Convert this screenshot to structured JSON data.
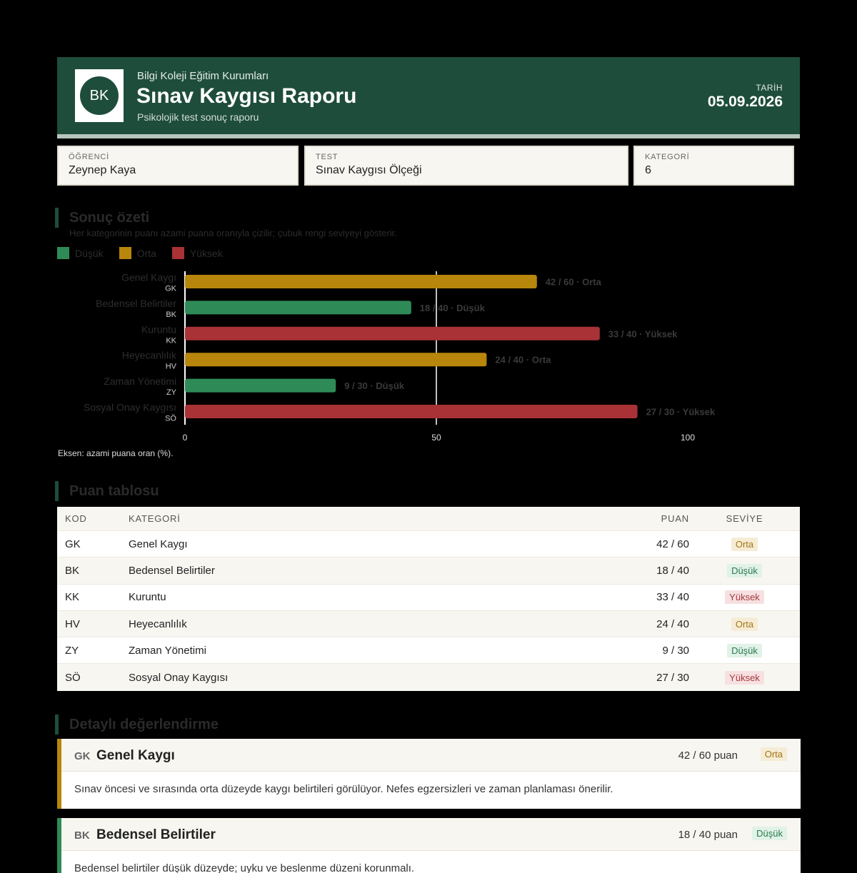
{
  "header": {
    "logo_text": "BK",
    "org": "Bilgi Koleji Eğitim Kurumları",
    "title": "Sınav Kaygısı Raporu",
    "subtitle": "Psikolojik test sonuç raporu",
    "date_label": "TARİH",
    "date": "05.09.2026"
  },
  "info": {
    "student_label": "ÖĞRENCİ",
    "student": "Zeynep Kaya",
    "test_label": "TEST",
    "test": "Sınav Kaygısı Ölçeği",
    "category_label": "KATEGORİ",
    "category_count": "6"
  },
  "summary": {
    "title": "Sonuç özeti",
    "description": "Her kategorinin puanı azami puana oranıyla çizilir; çubuk rengi seviyeyi gösterir.",
    "legend": [
      {
        "label": "Düşük",
        "color": "#2e8b57"
      },
      {
        "label": "Orta",
        "color": "#b8860b"
      },
      {
        "label": "Yüksek",
        "color": "#a83236"
      }
    ],
    "axis_note": "Eksen: azami puana oran (%)."
  },
  "chart_data": {
    "type": "bar",
    "orientation": "horizontal",
    "categories": [
      "Genel Kaygı",
      "Bedensel Belirtiler",
      "Kuruntu",
      "Heyecanlılık",
      "Zaman Yönetimi",
      "Sosyal Onay Kaygısı"
    ],
    "codes": [
      "GK",
      "BK",
      "KK",
      "HV",
      "ZY",
      "SÖ"
    ],
    "scores": [
      42,
      18,
      33,
      24,
      9,
      27
    ],
    "max_scores": [
      60,
      40,
      40,
      40,
      30,
      30
    ],
    "values": [
      70,
      45,
      82.5,
      60,
      30,
      90
    ],
    "levels": [
      "Orta",
      "Düşük",
      "Yüksek",
      "Orta",
      "Düşük",
      "Yüksek"
    ],
    "data_labels": [
      "42 / 60 · Orta",
      "18 / 40 · Düşük",
      "33 / 40 · Yüksek",
      "24 / 40 · Orta",
      "9 / 30 · Düşük",
      "27 / 30 · Yüksek"
    ],
    "xlim": [
      0,
      100
    ],
    "xticks": [
      "0",
      "50",
      "100"
    ],
    "reference_line": 50,
    "level_colors": {
      "Düşük": "#2e8b57",
      "Orta": "#b8860b",
      "Yüksek": "#a83236"
    }
  },
  "table": {
    "title": "Puan tablosu",
    "headers": [
      "KOD",
      "KATEGORİ",
      "PUAN",
      "SEVİYE"
    ],
    "rows": [
      {
        "code": "GK",
        "category": "Genel Kaygı",
        "score": "42 / 60",
        "level": "Orta"
      },
      {
        "code": "BK",
        "category": "Bedensel Belirtiler",
        "score": "18 / 40",
        "level": "Düşük"
      },
      {
        "code": "KK",
        "category": "Kuruntu",
        "score": "33 / 40",
        "level": "Yüksek"
      },
      {
        "code": "HV",
        "category": "Heyecanlılık",
        "score": "24 / 40",
        "level": "Orta"
      },
      {
        "code": "ZY",
        "category": "Zaman Yönetimi",
        "score": "9 / 30",
        "level": "Düşük"
      },
      {
        "code": "SÖ",
        "category": "Sosyal Onay Kaygısı",
        "score": "27 / 30",
        "level": "Yüksek"
      }
    ]
  },
  "details": {
    "title": "Detaylı değerlendirme",
    "cards": [
      {
        "code": "GK",
        "name": "Genel Kaygı",
        "score": "42 / 60 puan",
        "level": "Orta",
        "text": "Sınav öncesi ve sırasında orta düzeyde kaygı belirtileri görülüyor. Nefes egzersizleri ve zaman planlaması önerilir."
      },
      {
        "code": "BK",
        "name": "Bedensel Belirtiler",
        "score": "18 / 40 puan",
        "level": "Düşük",
        "text": "Bedensel belirtiler düşük düzeyde; uyku ve beslenme düzeni korunmalı."
      }
    ]
  }
}
